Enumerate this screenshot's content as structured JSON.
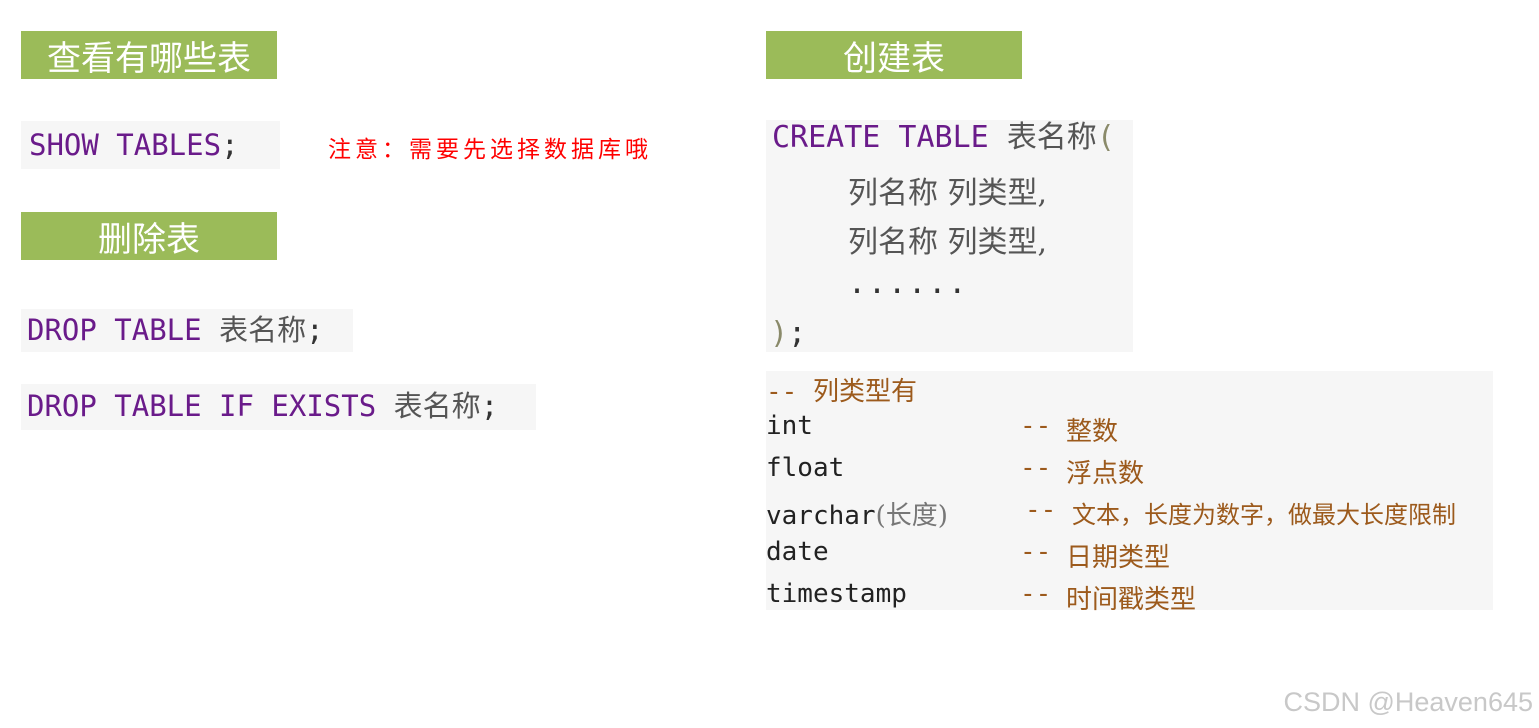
{
  "left": {
    "show_header": "查看有哪些表",
    "show_code": {
      "keyword": "SHOW TABLES",
      "end": ";"
    },
    "note": "注意：需要先选择数据库哦",
    "drop_header": "删除表",
    "drop_code_1": {
      "keyword": "DROP TABLE",
      "name": "表名称",
      "end": ";"
    },
    "drop_code_2": {
      "keyword": "DROP TABLE IF EXISTS",
      "name": "表名称",
      "end": ";"
    }
  },
  "right": {
    "create_header": "创建表",
    "create_code": {
      "keyword": "CREATE TABLE",
      "name": "表名称",
      "open": "(",
      "rows": [
        "列名称 列类型,",
        "列名称 列类型,",
        "......"
      ],
      "close": ")",
      "end": ";"
    },
    "types": {
      "title_dash": "--",
      "title": "列类型有",
      "rows": [
        {
          "type": "int",
          "arg": "",
          "dash": "--",
          "desc": "整数"
        },
        {
          "type": "float",
          "arg": "",
          "dash": "--",
          "desc": "浮点数"
        },
        {
          "type": "varchar",
          "arg": "(长度)",
          "dash": "--",
          "desc": "文本，长度为数字，做最大长度限制"
        },
        {
          "type": "date",
          "arg": "",
          "dash": "--",
          "desc": "日期类型"
        },
        {
          "type": "timestamp",
          "arg": "",
          "dash": "--",
          "desc": "时间戳类型"
        }
      ]
    }
  },
  "watermark": "CSDN @Heaven645"
}
